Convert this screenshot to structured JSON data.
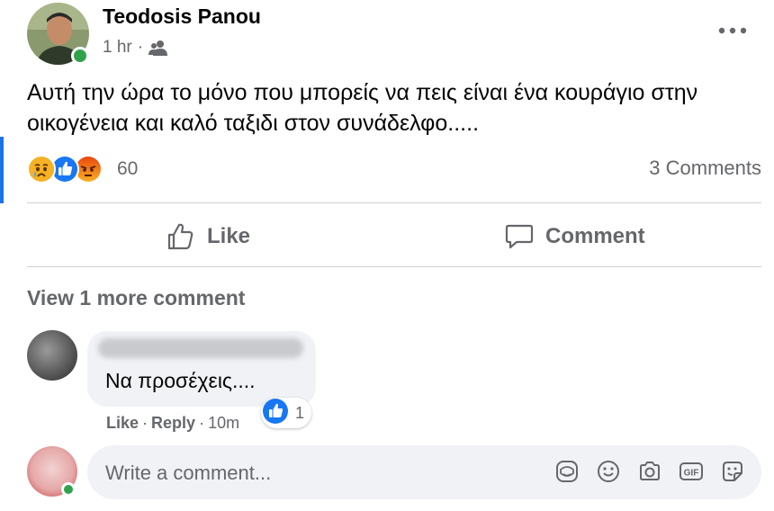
{
  "post": {
    "author": "Teodosis Panou",
    "time": "1 hr",
    "dot": "·",
    "audience_icon": "friends-icon",
    "text": "Αυτή την ώρα το μόνο που μπορείς να πεις είναι ένα κουράγιο στην οικογένεια και καλό ταξιδι στον συνάδελφο.....",
    "reaction_icons": [
      "sad-icon",
      "like-icon",
      "angry-icon"
    ],
    "reaction_count": "60",
    "comments_count": "3 Comments"
  },
  "actions": {
    "like_label": "Like",
    "comment_label": "Comment"
  },
  "comments": {
    "view_more": "View 1 more comment",
    "items": [
      {
        "text": "Να προσέχεις....",
        "like_label": "Like",
        "reply_label": "Reply",
        "separator": "·",
        "time": "10m",
        "like_count": "1"
      }
    ]
  },
  "composer": {
    "placeholder": "Write a comment...",
    "icons": [
      "avatar-sticker-icon",
      "emoji-icon",
      "camera-icon",
      "gif-icon",
      "sticker-icon"
    ]
  },
  "colors": {
    "accent": "#1b74e4",
    "online": "#31a24c",
    "secondary_text": "#65676b",
    "bubble": "#f0f2f5"
  }
}
